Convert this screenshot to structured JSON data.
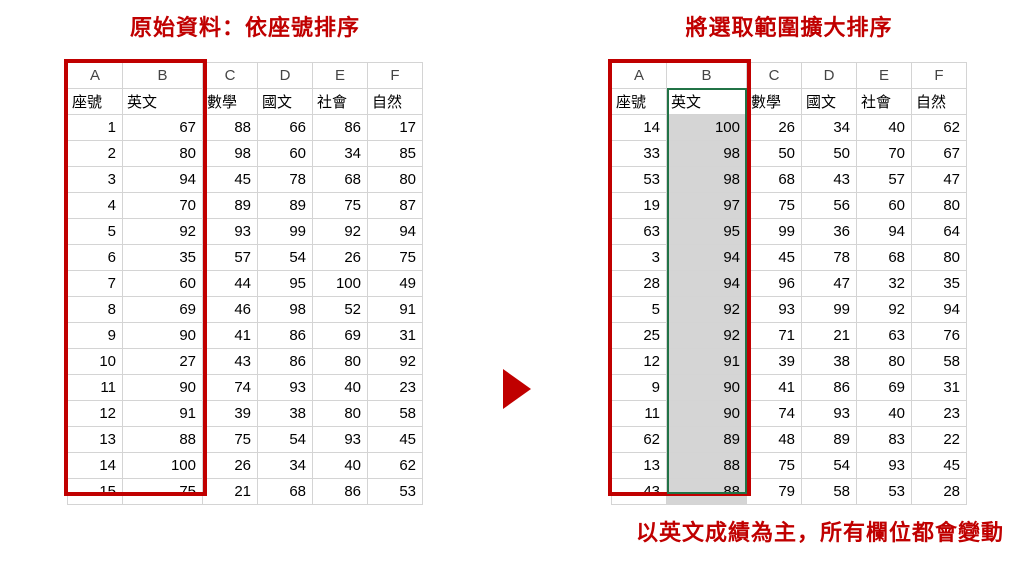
{
  "left": {
    "title": "原始資料：依座號排序",
    "col_letters": [
      "A",
      "B",
      "C",
      "D",
      "E",
      "F"
    ],
    "headers": [
      "座號",
      "英文",
      "數學",
      "國文",
      "社會",
      "自然"
    ],
    "rows": [
      [
        1,
        67,
        88,
        66,
        86,
        17
      ],
      [
        2,
        80,
        98,
        60,
        34,
        85
      ],
      [
        3,
        94,
        45,
        78,
        68,
        80
      ],
      [
        4,
        70,
        89,
        89,
        75,
        87
      ],
      [
        5,
        92,
        93,
        99,
        92,
        94
      ],
      [
        6,
        35,
        57,
        54,
        26,
        75
      ],
      [
        7,
        60,
        44,
        95,
        100,
        49
      ],
      [
        8,
        69,
        46,
        98,
        52,
        91
      ],
      [
        9,
        90,
        41,
        86,
        69,
        31
      ],
      [
        10,
        27,
        43,
        86,
        80,
        92
      ],
      [
        11,
        90,
        74,
        93,
        40,
        23
      ],
      [
        12,
        91,
        39,
        38,
        80,
        58
      ],
      [
        13,
        88,
        75,
        54,
        93,
        45
      ],
      [
        14,
        100,
        26,
        34,
        40,
        62
      ],
      [
        15,
        75,
        21,
        68,
        86,
        53
      ]
    ]
  },
  "right": {
    "title": "將選取範圍擴大排序",
    "caption": "以英文成績為主，所有欄位都會變動",
    "col_letters": [
      "A",
      "B",
      "C",
      "D",
      "E",
      "F"
    ],
    "headers": [
      "座號",
      "英文",
      "數學",
      "國文",
      "社會",
      "自然"
    ],
    "rows": [
      [
        14,
        100,
        26,
        34,
        40,
        62
      ],
      [
        33,
        98,
        50,
        50,
        70,
        67
      ],
      [
        53,
        98,
        68,
        43,
        57,
        47
      ],
      [
        19,
        97,
        75,
        56,
        60,
        80
      ],
      [
        63,
        95,
        99,
        36,
        94,
        64
      ],
      [
        3,
        94,
        45,
        78,
        68,
        80
      ],
      [
        28,
        94,
        96,
        47,
        32,
        35
      ],
      [
        5,
        92,
        93,
        99,
        92,
        94
      ],
      [
        25,
        92,
        71,
        21,
        63,
        76
      ],
      [
        12,
        91,
        39,
        38,
        80,
        58
      ],
      [
        9,
        90,
        41,
        86,
        69,
        31
      ],
      [
        11,
        90,
        74,
        93,
        40,
        23
      ],
      [
        62,
        89,
        48,
        89,
        83,
        22
      ],
      [
        13,
        88,
        75,
        54,
        93,
        45
      ],
      [
        43,
        88,
        79,
        58,
        53,
        28
      ]
    ]
  },
  "chart_data": {
    "type": "table",
    "title_left": "原始資料：依座號排序",
    "title_right": "將選取範圍擴大排序",
    "note": "以英文成績為主，所有欄位都會變動",
    "columns": [
      "座號",
      "英文",
      "數學",
      "國文",
      "社會",
      "自然"
    ],
    "left_sorted_by": "座號 ascending",
    "right_sorted_by": "英文 descending",
    "left_rows": [
      [
        1,
        67,
        88,
        66,
        86,
        17
      ],
      [
        2,
        80,
        98,
        60,
        34,
        85
      ],
      [
        3,
        94,
        45,
        78,
        68,
        80
      ],
      [
        4,
        70,
        89,
        89,
        75,
        87
      ],
      [
        5,
        92,
        93,
        99,
        92,
        94
      ],
      [
        6,
        35,
        57,
        54,
        26,
        75
      ],
      [
        7,
        60,
        44,
        95,
        100,
        49
      ],
      [
        8,
        69,
        46,
        98,
        52,
        91
      ],
      [
        9,
        90,
        41,
        86,
        69,
        31
      ],
      [
        10,
        27,
        43,
        86,
        80,
        92
      ],
      [
        11,
        90,
        74,
        93,
        40,
        23
      ],
      [
        12,
        91,
        39,
        38,
        80,
        58
      ],
      [
        13,
        88,
        75,
        54,
        93,
        45
      ],
      [
        14,
        100,
        26,
        34,
        40,
        62
      ],
      [
        15,
        75,
        21,
        68,
        86,
        53
      ]
    ],
    "right_rows": [
      [
        14,
        100,
        26,
        34,
        40,
        62
      ],
      [
        33,
        98,
        50,
        50,
        70,
        67
      ],
      [
        53,
        98,
        68,
        43,
        57,
        47
      ],
      [
        19,
        97,
        75,
        56,
        60,
        80
      ],
      [
        63,
        95,
        99,
        36,
        94,
        64
      ],
      [
        3,
        94,
        45,
        78,
        68,
        80
      ],
      [
        28,
        94,
        96,
        47,
        32,
        35
      ],
      [
        5,
        92,
        93,
        99,
        92,
        94
      ],
      [
        25,
        92,
        71,
        21,
        63,
        76
      ],
      [
        12,
        91,
        39,
        38,
        80,
        58
      ],
      [
        9,
        90,
        41,
        86,
        69,
        31
      ],
      [
        11,
        90,
        74,
        93,
        40,
        23
      ],
      [
        62,
        89,
        48,
        89,
        83,
        22
      ],
      [
        13,
        88,
        75,
        54,
        93,
        45
      ],
      [
        43,
        88,
        79,
        58,
        53,
        28
      ]
    ]
  }
}
